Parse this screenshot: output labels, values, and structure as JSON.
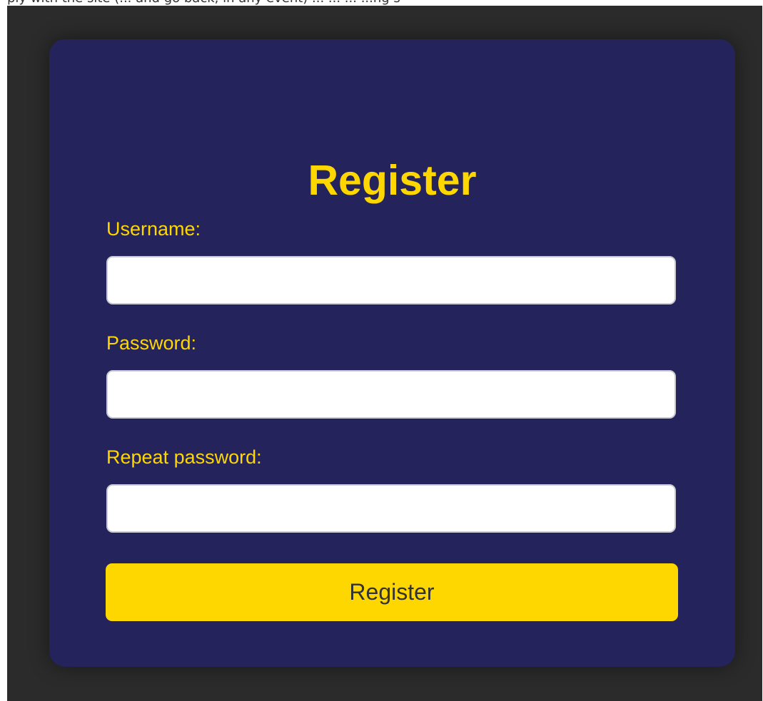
{
  "colors": {
    "backdrop": "#2b2b2b",
    "card": "#24235b",
    "accent": "#ffd700",
    "button_text": "#333333",
    "field_bg": "#ffffff"
  },
  "clipped_top_text": "ply with the site (... and go back, in any event) ... ... ... ...ng s",
  "form": {
    "title": "Register",
    "fields": [
      {
        "label": "Username:",
        "value": "",
        "type": "text"
      },
      {
        "label": "Password:",
        "value": "",
        "type": "password"
      },
      {
        "label": "Repeat password:",
        "value": "",
        "type": "password"
      }
    ],
    "submit_label": "Register"
  }
}
